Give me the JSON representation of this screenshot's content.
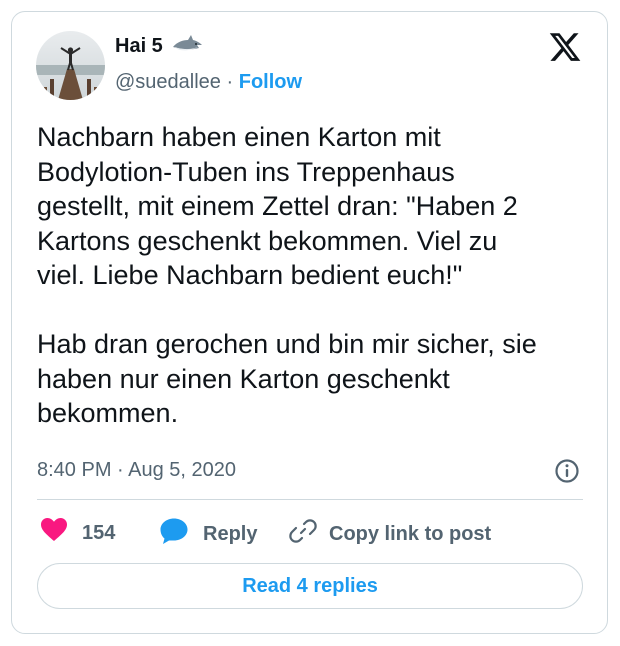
{
  "author": {
    "name": "Hai 5",
    "handle": "@suedallee",
    "separator": "·",
    "follow_label": "Follow",
    "badge_icon": "shark-icon",
    "avatar_icon": "person-on-pier-photo"
  },
  "platform_icon": "x-logo-icon",
  "post": {
    "text": "Nachbarn haben einen Karton mit\nBodylotion-Tuben ins Treppenhaus\ngestellt, mit einem Zettel dran: \"Haben 2\nKartons geschenkt bekommen. Viel zu\nviel. Liebe Nachbarn bedient euch!\"\n\nHab dran gerochen und bin mir sicher, sie\nhaben nur einen Karton geschenkt\nbekommen.",
    "timestamp": "8:40 PM · Aug 5, 2020",
    "info_icon": "info-icon"
  },
  "actions": {
    "likes_count": "154",
    "reply_label": "Reply",
    "copy_label": "Copy link to post"
  },
  "read_replies_label": "Read 4 replies",
  "colors": {
    "accent": "#1d9bf0",
    "like": "#f91880",
    "secondary_text": "#536471",
    "border": "#cfd9de"
  }
}
